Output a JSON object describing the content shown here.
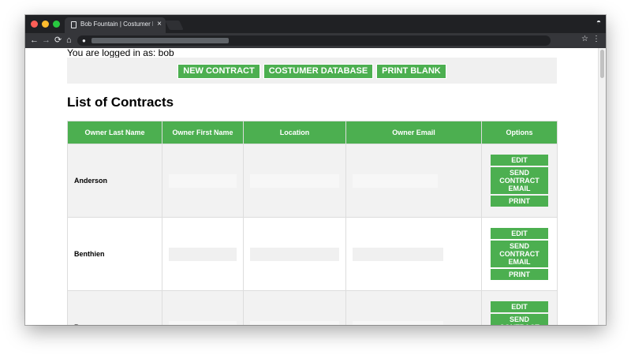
{
  "browser": {
    "tab_title": "Bob Fountain | Costumer Database",
    "tab_close": "×",
    "incognito_icon": "incognito-icon",
    "back": "←",
    "forward": "→",
    "reload": "⟳",
    "home": "⌂",
    "lock": "🔒",
    "star": "☆",
    "menu": "⋮"
  },
  "page": {
    "logged_in": "You are logged in as: bob",
    "nav": [
      "NEW CONTRACT",
      "COSTUMER DATABASE",
      "PRINT BLANK"
    ],
    "heading": "List of Contracts",
    "columns": [
      "Owner Last Name",
      "Owner First Name",
      "Location",
      "Owner Email",
      "Options"
    ],
    "rows": [
      {
        "last_name": "Anderson"
      },
      {
        "last_name": "Benthien"
      },
      {
        "last_name": "Boyer"
      }
    ],
    "options": {
      "edit": "EDIT",
      "send": "SEND CONTRACT EMAIL",
      "print": "PRINT"
    }
  },
  "colors": {
    "accent": "#4caf50",
    "nav_bg": "#f0f0f0",
    "chrome_dark": "#202124"
  }
}
